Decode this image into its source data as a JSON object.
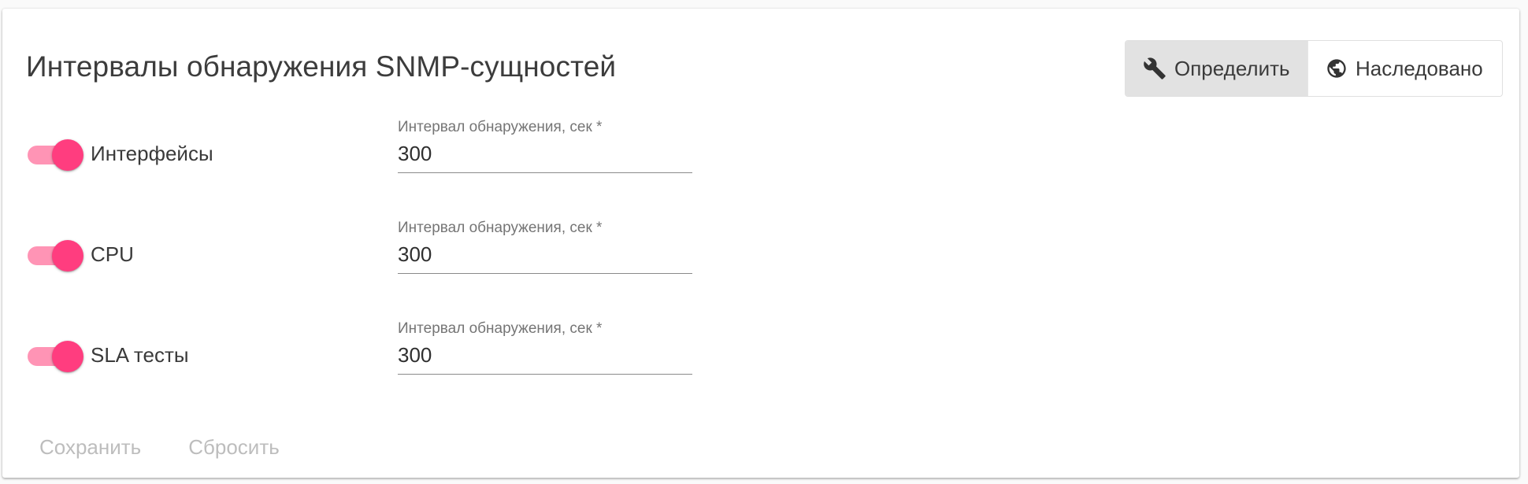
{
  "card": {
    "title": "Интервалы обнаружения SNMP-сущностей"
  },
  "mode_toggle": {
    "define_label": "Определить",
    "define_icon": "wrench-icon",
    "inherited_label": "Наследовано",
    "inherited_icon": "globe-icon",
    "selected": "define"
  },
  "rows": [
    {
      "label": "Интерфейсы",
      "enabled": true,
      "field_label": "Интервал обнаружения, сек *",
      "value": "300"
    },
    {
      "label": "CPU",
      "enabled": true,
      "field_label": "Интервал обнаружения, сек *",
      "value": "300"
    },
    {
      "label": "SLA тесты",
      "enabled": true,
      "field_label": "Интервал обнаружения, сек *",
      "value": "300"
    }
  ],
  "actions": {
    "save_label": "Сохранить",
    "reset_label": "Сбросить",
    "disabled": true
  },
  "colors": {
    "switch_track": "#ff94b5",
    "switch_thumb": "#ff3d7f",
    "active_toggle_bg": "#e2e2e2",
    "disabled_text": "#bdbdbd"
  }
}
